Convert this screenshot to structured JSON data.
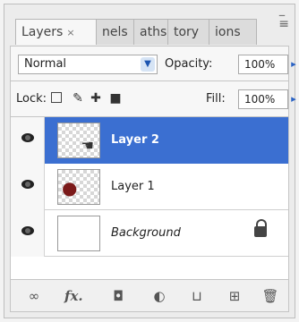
{
  "tabs": [
    {
      "label": "Layers",
      "active": true,
      "close": "×"
    },
    {
      "label": "nels"
    },
    {
      "label": "aths"
    },
    {
      "label": "tory"
    },
    {
      "label": "ions"
    }
  ],
  "blend_mode": {
    "value": "Normal"
  },
  "opacity": {
    "label": "Opacity:",
    "value": "100%"
  },
  "lock": {
    "label": "Lock:"
  },
  "fill": {
    "label": "Fill:",
    "value": "100%"
  },
  "layers": [
    {
      "name": "Layer 2",
      "selected": true
    },
    {
      "name": "Layer 1",
      "selected": false
    },
    {
      "name": "Background",
      "selected": false,
      "locked": true
    }
  ],
  "bottom_bar": {
    "icons": [
      "link-layers-icon",
      "fx-icon",
      "add-mask-icon",
      "adjustment-layer-icon",
      "new-group-icon",
      "new-layer-icon",
      "delete-layer-icon"
    ],
    "fx_label": "fx."
  },
  "colors": {
    "selection": "#3b6fd1",
    "panel": "#ececec"
  }
}
